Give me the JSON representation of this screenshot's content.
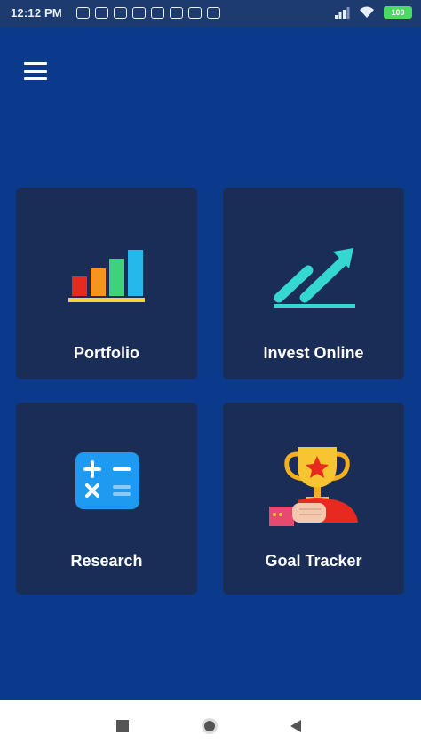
{
  "status_bar": {
    "time": "12:12 PM",
    "battery": "100"
  },
  "header": {
    "menu_icon": "hamburger-menu-icon"
  },
  "cards": [
    {
      "label": "Portfolio",
      "icon": "bar-chart-icon"
    },
    {
      "label": "Invest Online",
      "icon": "trending-up-icon"
    },
    {
      "label": "Research",
      "icon": "calculator-icon"
    },
    {
      "label": "Goal Tracker",
      "icon": "trophy-icon"
    }
  ],
  "nav_bar": {
    "icons": [
      "recents-square-icon",
      "home-circle-icon",
      "back-triangle-icon"
    ]
  },
  "colors": {
    "background": "#0b3a8c",
    "card": "#1a2d57",
    "status_bar": "#1d3b6e"
  }
}
